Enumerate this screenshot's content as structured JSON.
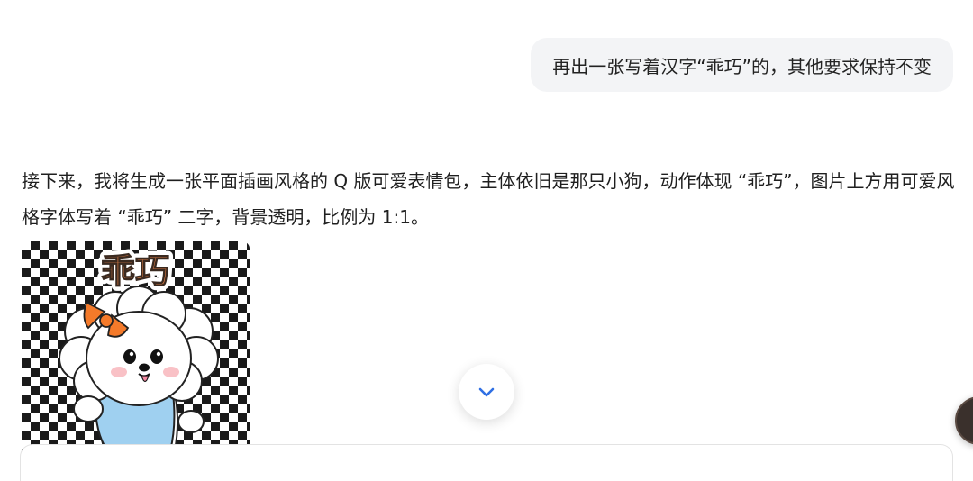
{
  "conversation": {
    "user_message": "再出一张写着汉字“乖巧”的，其他要求保持不变",
    "reply": "接下来，我将生成一张平面插画风格的 Q 版可爱表情包，主体依旧是那只小狗，动作体现 “乖巧”，图片上方用可爱风格字体写着 “乖巧” 二字，背景透明，比例为 1:1。",
    "image": {
      "caption_text": "乖巧",
      "background": "transparent-checkerboard"
    }
  },
  "controls": {
    "scroll_down_icon": "chevron-down-icon"
  },
  "colors": {
    "accent": "#2f6fe4",
    "user_bubble_bg": "#f3f4f6",
    "sticker_text": "#f5894a",
    "bow": "#f47a2a",
    "shirt": "#9fd0f0"
  }
}
